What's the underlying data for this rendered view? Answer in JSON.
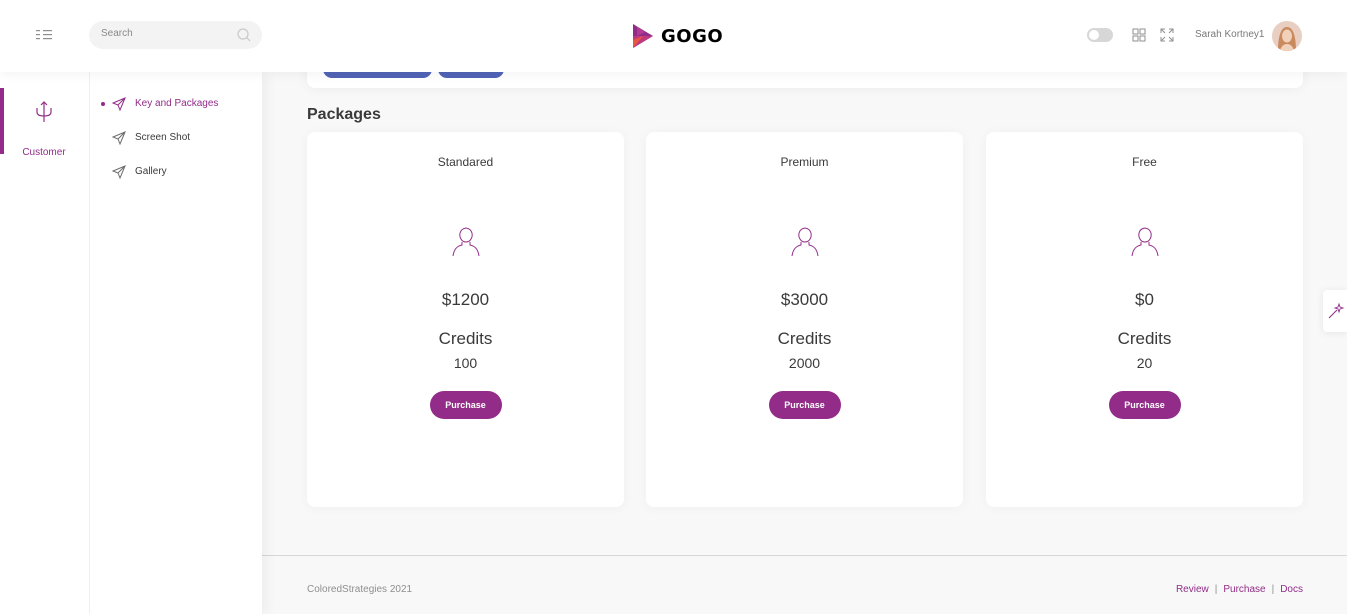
{
  "header": {
    "search_placeholder": "Search",
    "logo_text": "GOGO",
    "username": "Sarah Kortney1"
  },
  "main_menu": {
    "items": [
      {
        "label": "Customer",
        "icon": "trident-icon",
        "active": true
      }
    ]
  },
  "sub_menu": {
    "items": [
      {
        "label": "Key and Packages",
        "icon": "send-icon",
        "active": true
      },
      {
        "label": "Screen Shot",
        "icon": "send-icon",
        "active": false
      },
      {
        "label": "Gallery",
        "icon": "send-icon",
        "active": false
      }
    ]
  },
  "page": {
    "title": "Packages"
  },
  "packages": [
    {
      "name": "Standared",
      "price": "$1200",
      "credits_label": "Credits",
      "credits": "100",
      "button": "Purchase"
    },
    {
      "name": "Premium",
      "price": "$3000",
      "credits_label": "Credits",
      "credits": "2000",
      "button": "Purchase"
    },
    {
      "name": "Free",
      "price": "$0",
      "credits_label": "Credits",
      "credits": "20",
      "button": "Purchase"
    }
  ],
  "footer": {
    "copyright": "ColoredStrategies 2021",
    "links": [
      "Review",
      "Purchase",
      "Docs"
    ],
    "separator": "|"
  },
  "colors": {
    "primary": "#922c88",
    "secondary": "#5163b5",
    "background": "#f8f8f8"
  }
}
